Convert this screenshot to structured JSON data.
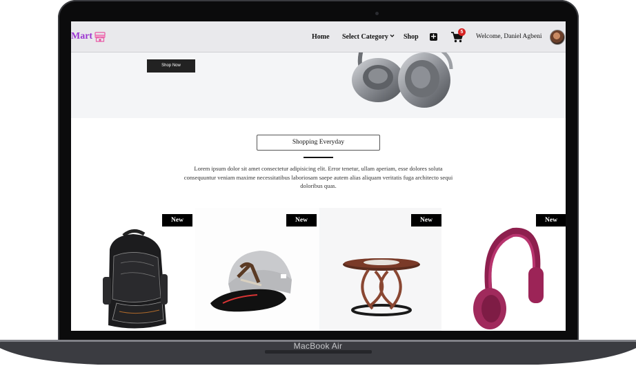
{
  "device": {
    "label": "MacBook Air"
  },
  "navbar": {
    "brand": "Mart",
    "brand_icon": "shop-icon",
    "brand_color": "#9b35d1",
    "links": {
      "home": "Home",
      "category": "Select Category",
      "shop": "Shop"
    },
    "cart_count": "5",
    "welcome": "Welcome, Daniel Agbeni"
  },
  "hero": {
    "cta": "Shop Now",
    "image": "headphones-gray"
  },
  "section": {
    "button": "Shopping Everyday",
    "text": "Lorem ipsum dolor sit amet consectetur adipisicing elit. Error tenetur, ullam aperiam, esse dolores soluta consequuntur veniam maxime necessitatibus laboriosam saepe autem alias aliquam veritatis fuga architecto sequi doloribus quas."
  },
  "products": [
    {
      "badge": "New",
      "image": "backpack"
    },
    {
      "badge": "New",
      "image": "cap"
    },
    {
      "badge": "New",
      "image": "table"
    },
    {
      "badge": "New",
      "image": "headphones-magenta"
    }
  ]
}
